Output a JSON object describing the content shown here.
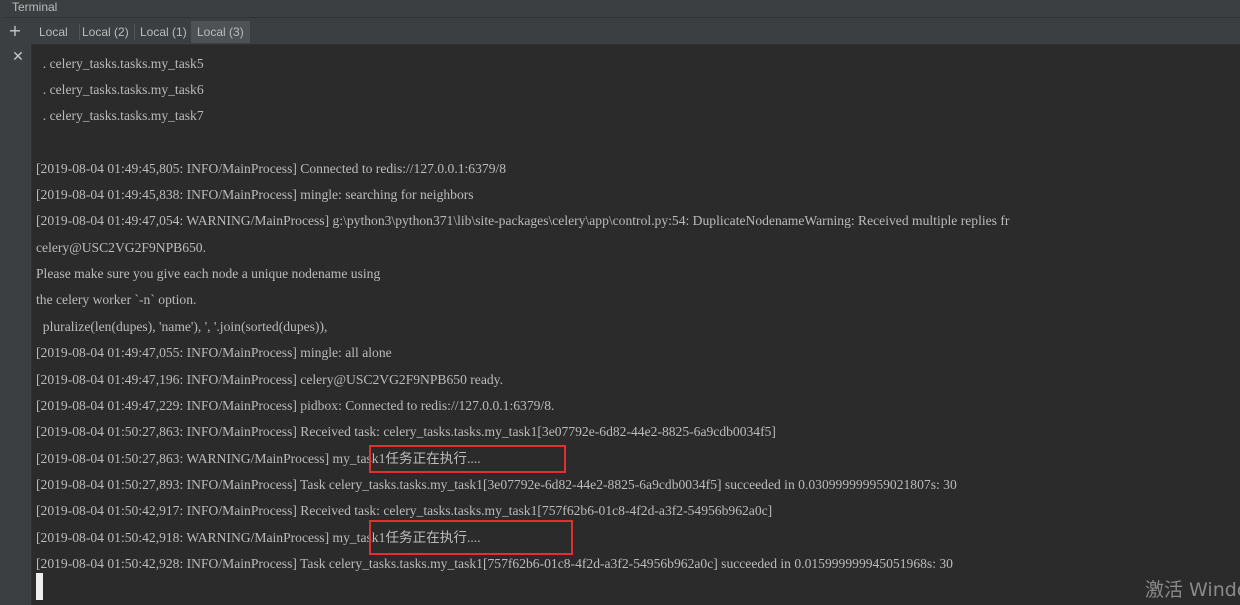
{
  "window": {
    "title": "Terminal"
  },
  "tabs": [
    {
      "label": "Local",
      "active": false
    },
    {
      "label": "Local (2)",
      "active": false
    },
    {
      "label": "Local (1)",
      "active": false
    },
    {
      "label": "Local (3)",
      "active": true
    }
  ],
  "toolbar": {
    "new_tab_icon": "plus-icon",
    "close_icon": "close-icon"
  },
  "terminal": {
    "lines": [
      "  . celery_tasks.tasks.my_task5",
      "  . celery_tasks.tasks.my_task6",
      "  . celery_tasks.tasks.my_task7",
      "",
      "[2019-08-04 01:49:45,805: INFO/MainProcess] Connected to redis://127.0.0.1:6379/8",
      "[2019-08-04 01:49:45,838: INFO/MainProcess] mingle: searching for neighbors",
      "[2019-08-04 01:49:47,054: WARNING/MainProcess] g:\\python3\\python371\\lib\\site-packages\\celery\\app\\control.py:54: DuplicateNodenameWarning: Received multiple replies fr",
      "celery@USC2VG2F9NPB650.",
      "Please make sure you give each node a unique nodename using",
      "the celery worker `-n` option.",
      "  pluralize(len(dupes), 'name'), ', '.join(sorted(dupes)),",
      "[2019-08-04 01:49:47,055: INFO/MainProcess] mingle: all alone",
      "[2019-08-04 01:49:47,196: INFO/MainProcess] celery@USC2VG2F9NPB650 ready.",
      "[2019-08-04 01:49:47,229: INFO/MainProcess] pidbox: Connected to redis://127.0.0.1:6379/8.",
      "[2019-08-04 01:50:27,863: INFO/MainProcess] Received task: celery_tasks.tasks.my_task1[3e07792e-6d82-44e2-8825-6a9cdb0034f5]",
      "[2019-08-04 01:50:27,863: WARNING/MainProcess] my_task1任务正在执行....",
      "[2019-08-04 01:50:27,893: INFO/MainProcess] Task celery_tasks.tasks.my_task1[3e07792e-6d82-44e2-8825-6a9cdb0034f5] succeeded in 0.030999999959021807s: 30",
      "[2019-08-04 01:50:42,917: INFO/MainProcess] Received task: celery_tasks.tasks.my_task1[757f62b6-01c8-4f2d-a3f2-54956b962a0c]",
      "[2019-08-04 01:50:42,918: WARNING/MainProcess] my_task1任务正在执行....",
      "[2019-08-04 01:50:42,928: INFO/MainProcess] Task celery_tasks.tasks.my_task1[757f62b6-01c8-4f2d-a3f2-54956b962a0c] succeeded in 0.015999999945051968s: 30"
    ]
  },
  "watermark": {
    "text": "激活 Windo"
  },
  "colors": {
    "background": "#2b2b2b",
    "text": "#bbbbbb",
    "highlight_box": "#e03030"
  }
}
